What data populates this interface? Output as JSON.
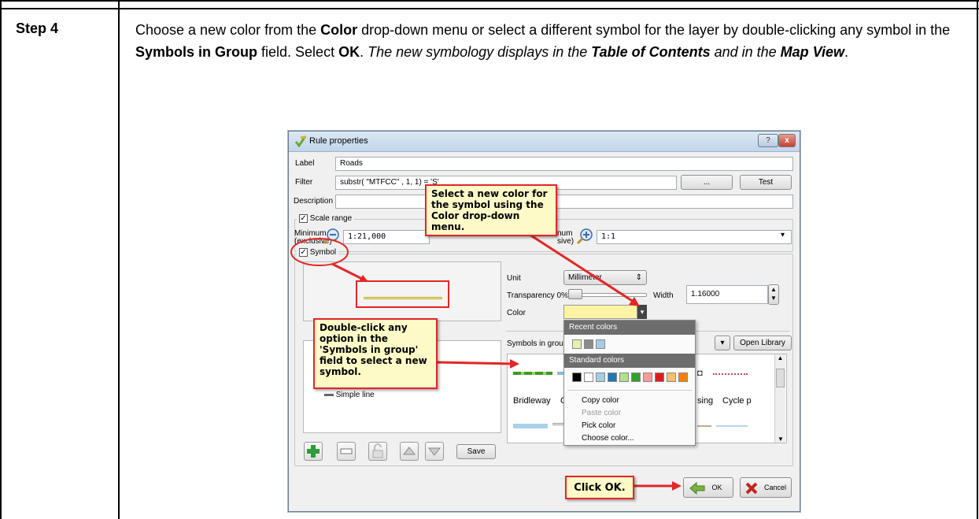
{
  "step": {
    "label": "Step 4",
    "text_1": "Choose a new color from the ",
    "text_color": "Color",
    "text_2": " drop-down menu or select a different symbol for the layer by double-clicking any symbol in the ",
    "text_symbols": "Symbols in Group",
    "text_3": " field. Select ",
    "text_ok": "OK",
    "text_4": ". ",
    "text_5": "The new symbology displays in the ",
    "text_toc": "Table of Contents",
    "text_6": " and in the ",
    "text_mapview": "Map View",
    "text_7": "."
  },
  "dialog": {
    "title": "Rule properties",
    "help_label": "?",
    "close_label": "x",
    "label_label": "Label",
    "label_value": "Roads",
    "filter_label": "Filter",
    "filter_value": "substr( \"MTFCC\" , 1, 1) = 'S'",
    "filter_more": "...",
    "test_label": "Test",
    "description_label": "Description",
    "description_value": "",
    "scale_range_title": "Scale range",
    "minimum_label": "Minimum\n(exclusive)",
    "minimum_value": "1:21,000",
    "maximum_label_partial": "num\nsive)",
    "maximum_value": "1:1",
    "symbol_title": "Symbol",
    "unit_label": "Unit",
    "unit_value": "Millimeter",
    "transparency_label": "Transparency 0%",
    "width_label": "Width",
    "width_value": "1.16000",
    "color_label": "Color",
    "symbols_in_group_label": "Symbols in group",
    "open_library_label": "Open Library",
    "tree_item": "Simple line",
    "save_label": "Save",
    "ok_label": "OK",
    "cancel_label": "Cancel",
    "symbol_names": [
      "Bridleway",
      "C",
      "sing",
      "Cycle p"
    ]
  },
  "color_menu": {
    "recent_header": "Recent colors",
    "standard_header": "Standard colors",
    "recent_colors": [
      "#e8efb0",
      "#8c8c8c",
      "#a8cbe6"
    ],
    "standard_colors": [
      "#000000",
      "#ffffff",
      "#a6cee3",
      "#1f78b4",
      "#b2df8a",
      "#33a02c",
      "#fb9a99",
      "#e31a1c",
      "#fdbf6f",
      "#ff7f00"
    ],
    "items": [
      {
        "label": "Copy color",
        "enabled": true
      },
      {
        "label": "Paste color",
        "enabled": false
      },
      {
        "label": "Pick color",
        "enabled": true
      },
      {
        "label": "Choose color...",
        "enabled": true
      }
    ]
  },
  "callouts": {
    "color_tip": "Select a new color for the symbol using the Color drop-down menu.",
    "symbol_tip": "Double-click any option in the 'Symbols in group' field to select a new symbol.",
    "ok_tip": "Click OK."
  },
  "colors": {
    "callout_border": "#e32626",
    "callout_fill": "#fdfac8",
    "color_swatch": "#fdf3a5"
  }
}
